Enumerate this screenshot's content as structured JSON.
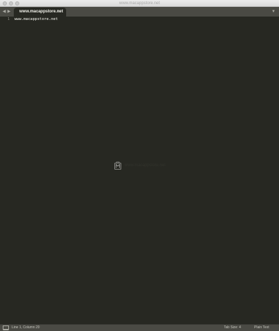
{
  "window": {
    "title": "www.macappstore.net",
    "buttons": [
      "close",
      "minimize",
      "zoom"
    ]
  },
  "tabbar": {
    "nav_back": "◀",
    "nav_forward": "▶",
    "tabs": [
      {
        "label": "www.macappstore.net",
        "close_glyph": "×",
        "active": true
      }
    ],
    "dropdown_glyph": "▼"
  },
  "editor": {
    "theme": {
      "background": "#272822",
      "text": "#f8f8f2",
      "gutter_text": "#90908a"
    },
    "lines": [
      {
        "number": "1",
        "text": "www.macappstore.net"
      }
    ]
  },
  "watermark": {
    "icon": "m-logo-icon",
    "text": "www.macappstore.net"
  },
  "statusbar": {
    "console_icon": "console-icon",
    "position": "Line 1, Column 20",
    "tab_size": "Tab Size: 4",
    "syntax": "Plain Text"
  }
}
